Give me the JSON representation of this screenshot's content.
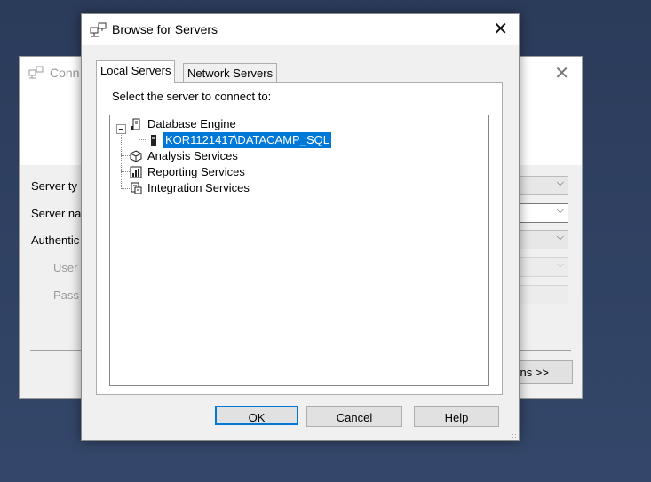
{
  "background_window": {
    "title": "Conn",
    "labels": [
      "Server ty",
      "Server na",
      "Authentic",
      "User",
      "Pass"
    ],
    "options_button": "ns >>"
  },
  "dialog": {
    "title": "Browse for Servers",
    "tabs": [
      {
        "label": "Local Servers",
        "active": true
      },
      {
        "label": "Network Servers",
        "active": false
      }
    ],
    "instruction": "Select the server to connect to:",
    "tree": {
      "root": "Database Engine",
      "selected_server": "KOR1121417\\DATACAMP_SQL",
      "services": [
        "Analysis Services",
        "Reporting Services",
        "Integration Services"
      ]
    },
    "buttons": {
      "ok": "OK",
      "cancel": "Cancel",
      "help": "Help"
    }
  },
  "icons": {
    "window_icon": "server-connect-icon",
    "database_engine": "database-engine-icon",
    "server": "server-icon",
    "analysis": "cube-icon",
    "reporting": "report-icon",
    "integration": "integration-icon"
  },
  "colors": {
    "selection": "#0078d7",
    "desktop": "#2d3e5f"
  }
}
